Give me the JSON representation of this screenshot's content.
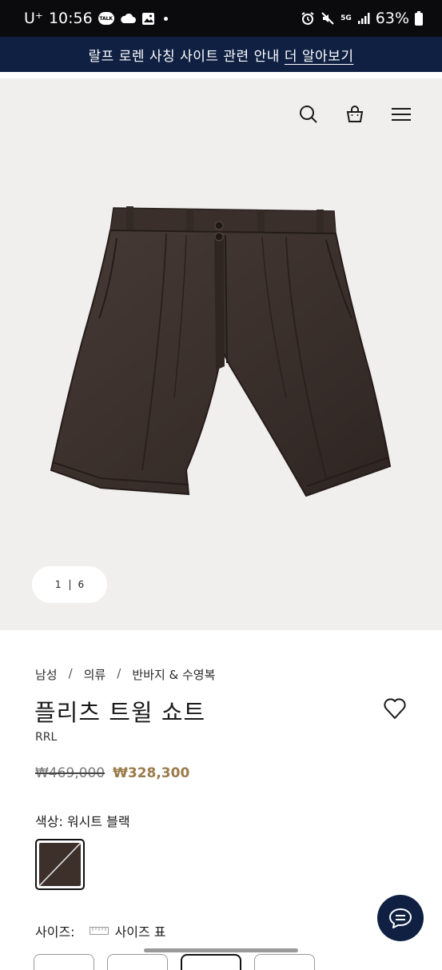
{
  "status_bar": {
    "carrier": "U⁺",
    "time": "10:56",
    "talk_badge": "TALK",
    "network": "5G",
    "battery": "63%"
  },
  "banner": {
    "text": "랄프 로렌 사칭 사이트 관련 안내",
    "link": "더 알아보기"
  },
  "gallery": {
    "current": "1",
    "total": "6",
    "product_colors": {
      "fabric": "#3b302c",
      "fabric_shadow": "#2a211e",
      "background": "#f0efee"
    }
  },
  "breadcrumb": {
    "items": [
      "남성",
      "의류",
      "반바지 & 수영복"
    ],
    "separator": "/"
  },
  "product": {
    "title": "플리츠 트윌 쇼트",
    "brand": "RRL",
    "price_original": "₩469,000",
    "price_sale": "₩328,300"
  },
  "color": {
    "label": "색상: 워시트 블랙",
    "swatch_color": "#3d302a"
  },
  "size": {
    "label": "사이즈:",
    "guide": "사이즈 표"
  },
  "colors": {
    "banner_bg": "#0f2042",
    "sale_price": "#9a7b4b",
    "chat_button": "#0f2042"
  }
}
